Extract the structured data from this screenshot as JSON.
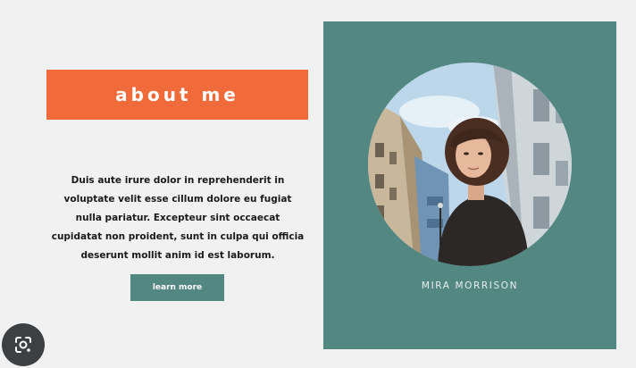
{
  "about": {
    "title": "about me"
  },
  "bio": {
    "text": "Duis aute irure dolor in reprehenderit in voluptate velit esse cillum dolore eu fugiat nulla pariatur. Excepteur sint occaecat cupidatat non proident, sunt in culpa qui officia deserunt mollit anim id est laborum."
  },
  "cta": {
    "label": "learn more"
  },
  "profile": {
    "name": "MIRA MORRISON",
    "photo": "portrait-photo"
  },
  "overlay": {
    "icon": "lens-search-icon"
  },
  "colors": {
    "background": "#f1f1f1",
    "accent": "#f06a3a",
    "teal": "#528782",
    "text": "#1a1a1a"
  }
}
